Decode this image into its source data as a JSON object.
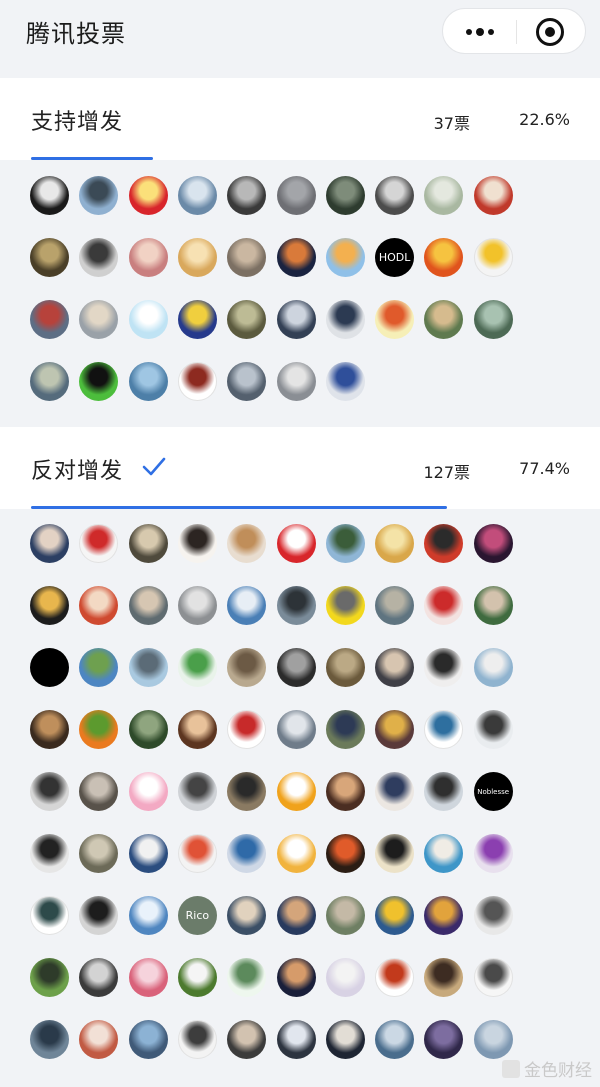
{
  "app": {
    "title": "腾讯投票"
  },
  "options": [
    {
      "label": "支持增发",
      "votes": "37票",
      "percent": "22.6%",
      "progress_fraction": 0.226,
      "selected": false,
      "avatars": [
        {
          "bg": "#1a1a1a",
          "accent": "#e8e8e8"
        },
        {
          "bg": "#8fb0d0",
          "accent": "#3b4a56"
        },
        {
          "bg": "#d8252b",
          "accent": "#fbe07a"
        },
        {
          "bg": "#6b8aa8",
          "accent": "#d9e4ee"
        },
        {
          "bg": "#3a3a3a",
          "accent": "#b8b8b8"
        },
        {
          "bg": "#6e6f74",
          "accent": "#a3a5a9"
        },
        {
          "bg": "#2e3c2f",
          "accent": "#7e8c7a"
        },
        {
          "bg": "#4c4c4c",
          "accent": "#d5d5d5"
        },
        {
          "bg": "#a9b8a1",
          "accent": "#e4e8df"
        },
        {
          "bg": "#c0392b",
          "accent": "#f0e0d0"
        },
        {
          "bg": "#4a3f28",
          "accent": "#b9a26b"
        },
        {
          "bg": "#cfcfcf",
          "accent": "#3a3a3a"
        },
        {
          "bg": "#c97f7f",
          "accent": "#f1d2c4"
        },
        {
          "bg": "#d9a85c",
          "accent": "#f7e1b3"
        },
        {
          "bg": "#7c7063",
          "accent": "#cab7a1"
        },
        {
          "bg": "#1a2340",
          "accent": "#d97a3a"
        },
        {
          "bg": "#8fc0e8",
          "accent": "#f3b04f"
        },
        {
          "bg": "#000000",
          "accent": "#ffffff",
          "text": "HODL"
        },
        {
          "bg": "#e0541d",
          "accent": "#f6c340"
        },
        {
          "bg": "#f4f4f4",
          "accent": "#f2c22a"
        },
        {
          "bg": "#5d6e85",
          "accent": "#b7423b"
        },
        {
          "bg": "#9aa1a8",
          "accent": "#e2d7c6"
        },
        {
          "bg": "#bfe3f4",
          "accent": "#ffffff"
        },
        {
          "bg": "#263a8c",
          "accent": "#f0cf3e"
        },
        {
          "bg": "#5b5a3e",
          "accent": "#bdbb95"
        },
        {
          "bg": "#334055",
          "accent": "#cdd4de"
        },
        {
          "bg": "#dfe2e6",
          "accent": "#2c3a52"
        },
        {
          "bg": "#f6efb7",
          "accent": "#e05a2b"
        },
        {
          "bg": "#5f7a4f",
          "accent": "#d6bb8e"
        },
        {
          "bg": "#4d6a55",
          "accent": "#a8c2b1"
        },
        {
          "bg": "#556b7c",
          "accent": "#bec5b1"
        },
        {
          "bg": "#4cbd3c",
          "accent": "#111111"
        },
        {
          "bg": "#4d7fa8",
          "accent": "#9fc6e3"
        },
        {
          "bg": "#ffffff",
          "accent": "#8d2a20"
        },
        {
          "bg": "#54606e",
          "accent": "#b9c2cc"
        },
        {
          "bg": "#8a8e94",
          "accent": "#e4e4e4"
        },
        {
          "bg": "#dfe3ea",
          "accent": "#2f4f9a"
        }
      ]
    },
    {
      "label": "反对增发",
      "votes": "127票",
      "percent": "77.4%",
      "progress_fraction": 0.774,
      "selected": true,
      "avatars": [
        {
          "bg": "#2c3f63",
          "accent": "#e3d2c4"
        },
        {
          "bg": "#f5f5f5",
          "accent": "#cf2a2a"
        },
        {
          "bg": "#4f4a3c",
          "accent": "#d7c9ae"
        },
        {
          "bg": "#f6f3ef",
          "accent": "#2c2522"
        },
        {
          "bg": "#e8ddd0",
          "accent": "#c08e5a"
        },
        {
          "bg": "#d8262b",
          "accent": "#ffffff"
        },
        {
          "bg": "#8fb6d6",
          "accent": "#3b5d3a"
        },
        {
          "bg": "#d9a74a",
          "accent": "#f4e3a7"
        },
        {
          "bg": "#cf3b2a",
          "accent": "#2b2b2b"
        },
        {
          "bg": "#2a1630",
          "accent": "#c24d7b"
        },
        {
          "bg": "#1d1d1d",
          "accent": "#e8b64d"
        },
        {
          "bg": "#cf4a30",
          "accent": "#f3d9c3"
        },
        {
          "bg": "#5f6b70",
          "accent": "#d6c6b2"
        },
        {
          "bg": "#8d9093",
          "accent": "#e2e2e2"
        },
        {
          "bg": "#4a7fb6",
          "accent": "#e7eef5"
        },
        {
          "bg": "#7a8b99",
          "accent": "#2d3338"
        },
        {
          "bg": "#f2d81d",
          "accent": "#6a6a6a"
        },
        {
          "bg": "#5f7480",
          "accent": "#b6b2a4"
        },
        {
          "bg": "#f3e3e1",
          "accent": "#cc2b2b"
        },
        {
          "bg": "#3f6b3f",
          "accent": "#d3c2ad"
        },
        {
          "bg": "#000000",
          "accent": "#000000"
        },
        {
          "bg": "#4d86c2",
          "accent": "#6ea04f"
        },
        {
          "bg": "#a9c9e0",
          "accent": "#5b6b77"
        },
        {
          "bg": "#e9f3ea",
          "accent": "#4a9f4a"
        },
        {
          "bg": "#b9a98f",
          "accent": "#6c5a45"
        },
        {
          "bg": "#2b2b2b",
          "accent": "#a0a0a0"
        },
        {
          "bg": "#6b5a3c",
          "accent": "#bba985"
        },
        {
          "bg": "#3f3f46",
          "accent": "#d7c5b0"
        },
        {
          "bg": "#efeeee",
          "accent": "#2a2a2a"
        },
        {
          "bg": "#8fb3cf",
          "accent": "#eeeeee"
        },
        {
          "bg": "#3a2a1e",
          "accent": "#bf8f5c"
        },
        {
          "bg": "#ea7a1f",
          "accent": "#5c9a2e"
        },
        {
          "bg": "#2e4a2a",
          "accent": "#8fa57f"
        },
        {
          "bg": "#5c3520",
          "accent": "#e8c29a"
        },
        {
          "bg": "#ffffff",
          "accent": "#c72a2a"
        },
        {
          "bg": "#6f7c8a",
          "accent": "#e1e5ea"
        },
        {
          "bg": "#6b7a5a",
          "accent": "#2d3a55"
        },
        {
          "bg": "#5a3a3a",
          "accent": "#e0b049"
        },
        {
          "bg": "#ffffff",
          "accent": "#2e6f9f"
        },
        {
          "bg": "#e9ecef",
          "accent": "#3a3a3a"
        },
        {
          "bg": "#d6d6d6",
          "accent": "#333333"
        },
        {
          "bg": "#58524a",
          "accent": "#c9c0b5"
        },
        {
          "bg": "#f3a9c3",
          "accent": "#ffffff"
        },
        {
          "bg": "#cfd2d6",
          "accent": "#444444"
        },
        {
          "bg": "#8a7a62",
          "accent": "#2a2a2a"
        },
        {
          "bg": "#f0a21b",
          "accent": "#ffffff"
        },
        {
          "bg": "#4b2e22",
          "accent": "#d8a67a"
        },
        {
          "bg": "#ece7e2",
          "accent": "#2f3d5f"
        },
        {
          "bg": "#cfd6dd",
          "accent": "#2f2f2f"
        },
        {
          "bg": "#000000",
          "accent": "#ffffff",
          "text": "Noblesse"
        },
        {
          "bg": "#e6e6e6",
          "accent": "#222222"
        },
        {
          "bg": "#6c6a58",
          "accent": "#cfc8b4"
        },
        {
          "bg": "#2b4d7f",
          "accent": "#f1f1f1"
        },
        {
          "bg": "#f3f3f3",
          "accent": "#e05236"
        },
        {
          "bg": "#cfd8e6",
          "accent": "#2f6aa8"
        },
        {
          "bg": "#f1b33e",
          "accent": "#ffffff"
        },
        {
          "bg": "#2b1d14",
          "accent": "#e05b2a"
        },
        {
          "bg": "#ece2c8",
          "accent": "#1d1d1d"
        },
        {
          "bg": "#3e96c8",
          "accent": "#f0ece5"
        },
        {
          "bg": "#e8e0ee",
          "accent": "#8b3fb0"
        },
        {
          "bg": "#ffffff",
          "accent": "#2d4a4a"
        },
        {
          "bg": "#d4d4d4",
          "accent": "#1d1d1d"
        },
        {
          "bg": "#4f86c0",
          "accent": "#e9f2fb"
        },
        {
          "bg": "#6b7c6a",
          "accent": "#ffffff",
          "text": "Rico"
        },
        {
          "bg": "#3b4f66",
          "accent": "#e1d2be"
        },
        {
          "bg": "#283a5e",
          "accent": "#d4a57b"
        },
        {
          "bg": "#6e7f63",
          "accent": "#c4b9a6"
        },
        {
          "bg": "#2d5a8f",
          "accent": "#f0c12d"
        },
        {
          "bg": "#3a2a6a",
          "accent": "#e2a33c"
        },
        {
          "bg": "#e8e8e8",
          "accent": "#555555"
        },
        {
          "bg": "#6da04a",
          "accent": "#2e3b2a"
        },
        {
          "bg": "#3b3b3b",
          "accent": "#d3d3d3"
        },
        {
          "bg": "#d9627a",
          "accent": "#f6d3dc"
        },
        {
          "bg": "#4c7a2e",
          "accent": "#f5f5f5"
        },
        {
          "bg": "#eef7ee",
          "accent": "#5c8a5c"
        },
        {
          "bg": "#1a1f3a",
          "accent": "#d69b6a"
        },
        {
          "bg": "#d8d2e4",
          "accent": "#f3f3f3"
        },
        {
          "bg": "#ffffff",
          "accent": "#c23a1c"
        },
        {
          "bg": "#c7a97c",
          "accent": "#3d2c22"
        },
        {
          "bg": "#f6f6f6",
          "accent": "#4a4a4a"
        },
        {
          "bg": "#6f8598",
          "accent": "#2a3a4a"
        },
        {
          "bg": "#c15a43",
          "accent": "#f2e0d6"
        },
        {
          "bg": "#405a78",
          "accent": "#8cb2d4"
        },
        {
          "bg": "#f3f3f3",
          "accent": "#3d3d3d"
        },
        {
          "bg": "#3b3b3b",
          "accent": "#d2c2b0"
        },
        {
          "bg": "#2d3440",
          "accent": "#e1e6ee"
        },
        {
          "bg": "#1e2533",
          "accent": "#e2ddd5"
        },
        {
          "bg": "#4a6d8d",
          "accent": "#cbd8e4"
        },
        {
          "bg": "#30284a",
          "accent": "#7d6da0"
        },
        {
          "bg": "#7e98b2",
          "accent": "#c9d5e0"
        }
      ]
    }
  ],
  "icons": {
    "more": "more-dots-icon",
    "close": "mini-program-close-icon",
    "check": "checkmark-icon"
  },
  "colors": {
    "accent": "#2f6fe4",
    "background": "#f1f3f6"
  },
  "watermark": "金色财经"
}
